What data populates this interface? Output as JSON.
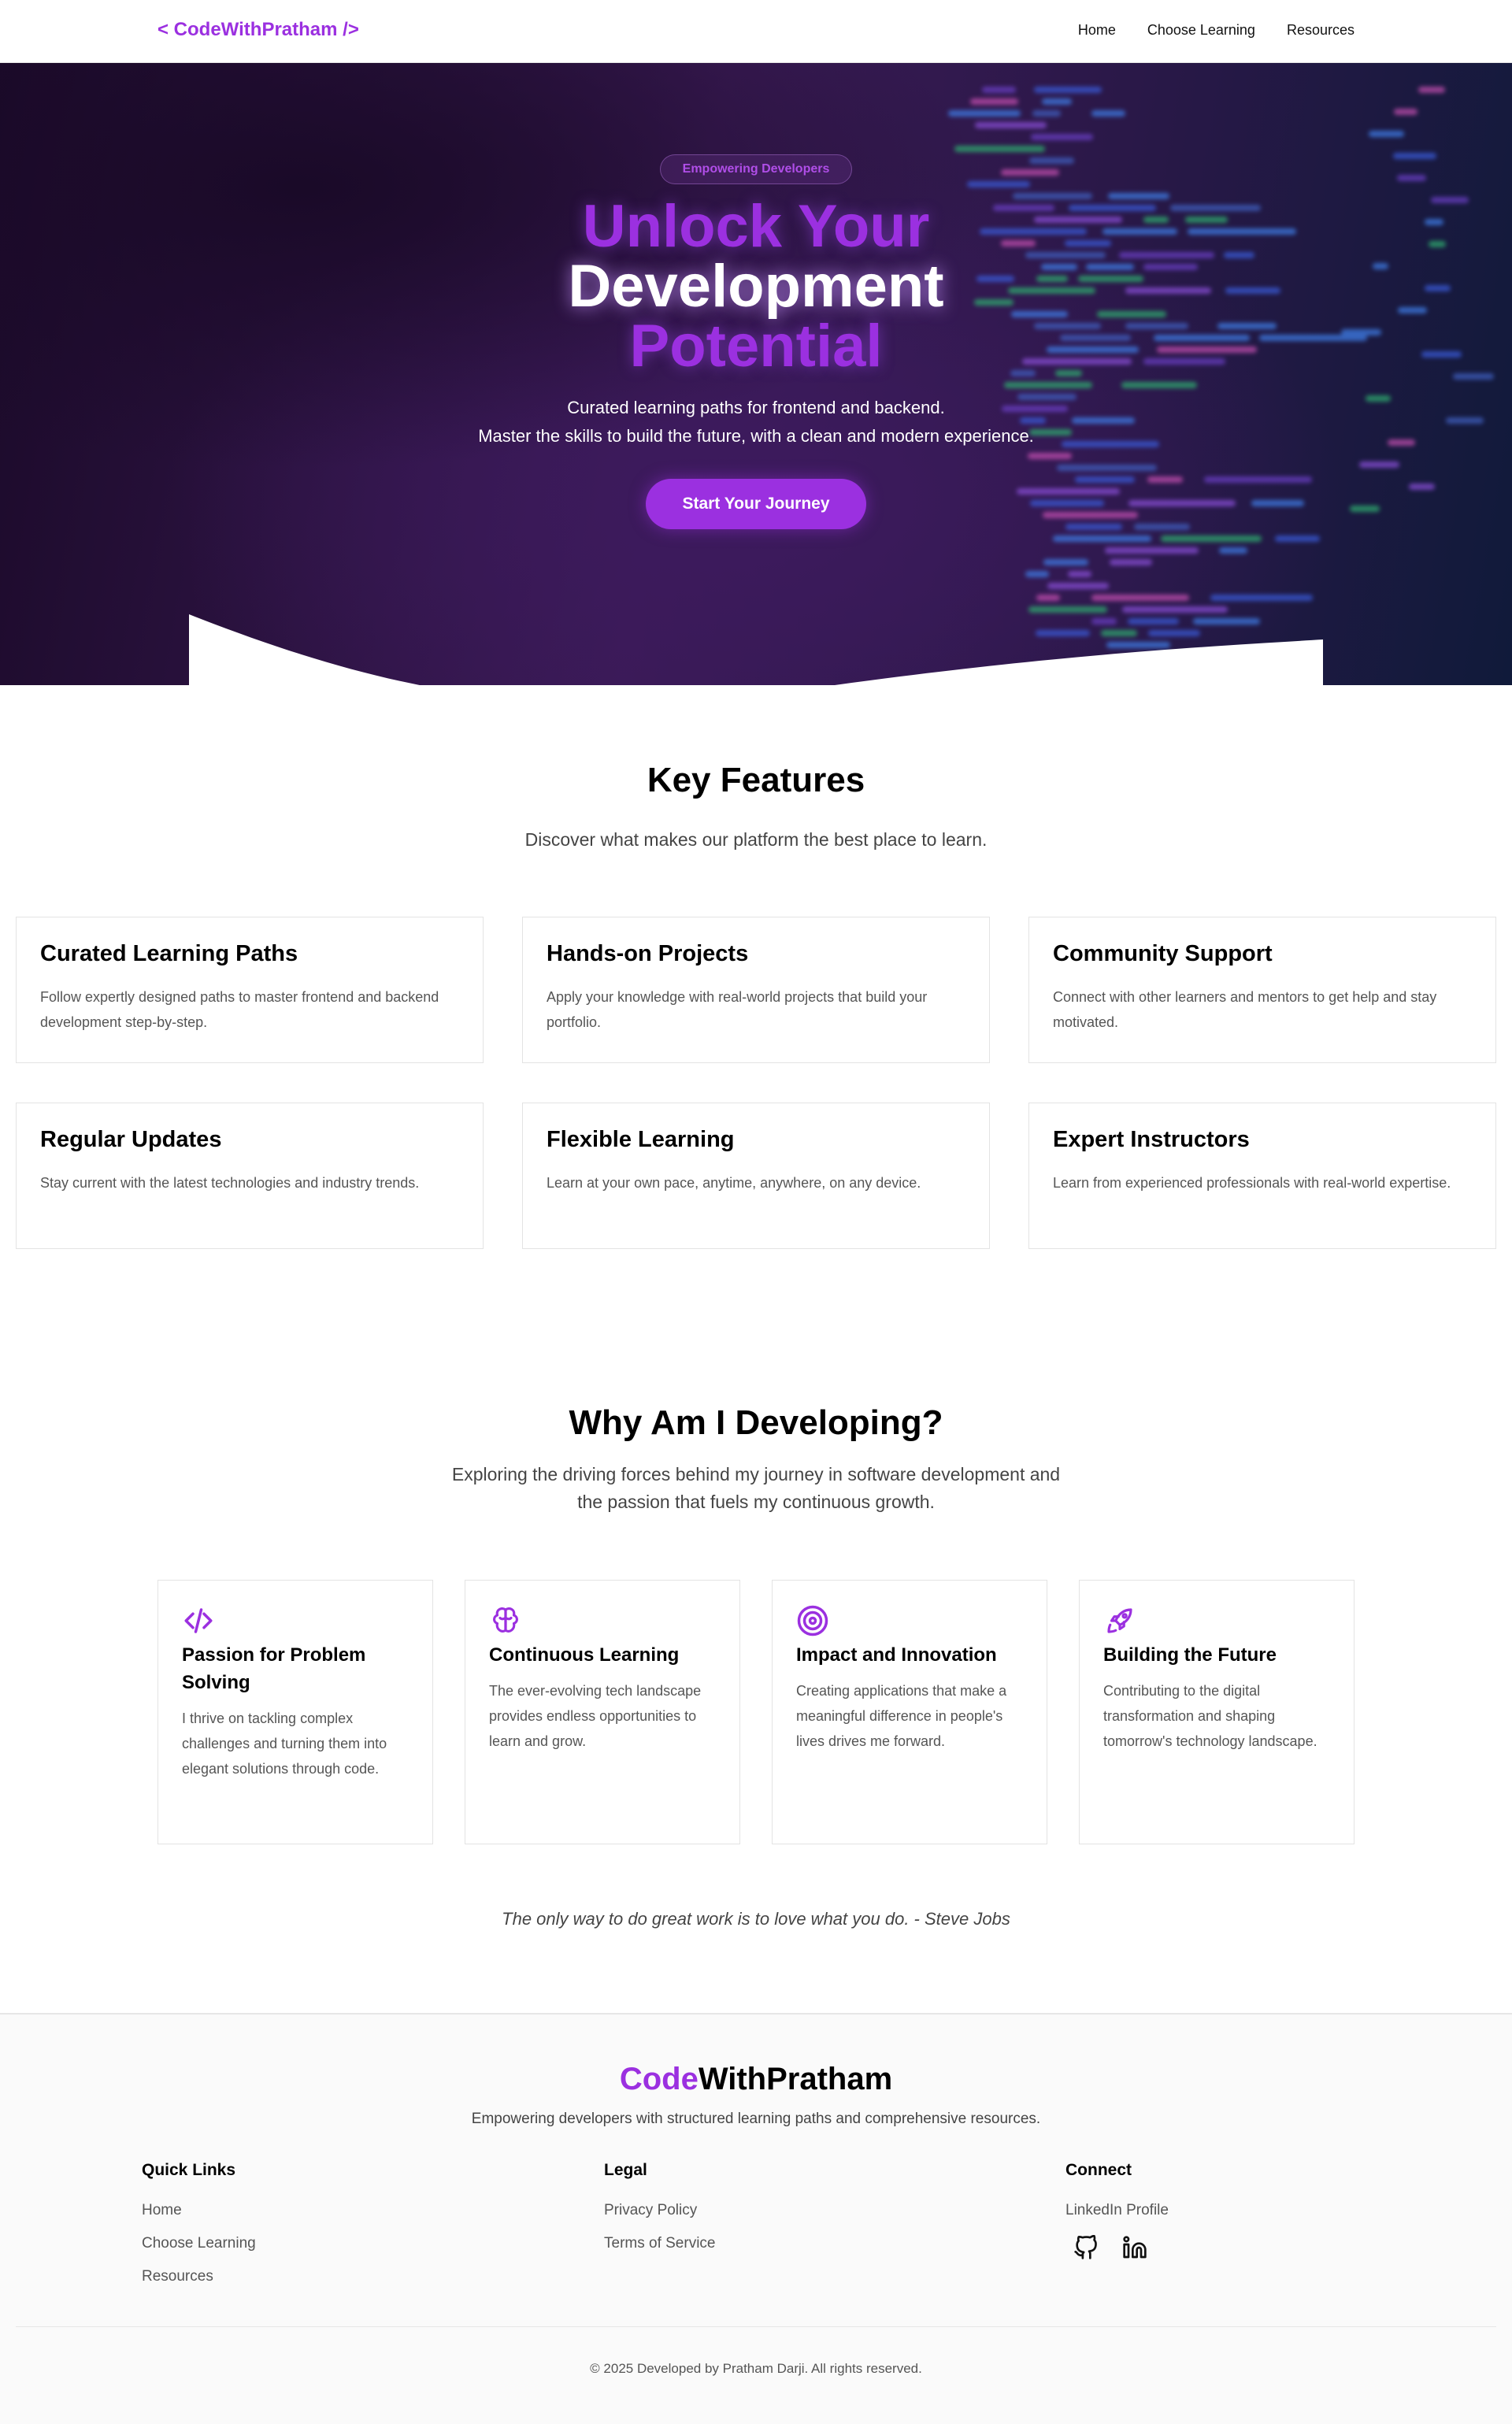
{
  "brand": {
    "logo_text": "< CodeWithPratham />",
    "accent_color": "#9b30e0"
  },
  "nav": {
    "items": [
      {
        "label": "Home"
      },
      {
        "label": "Choose Learning"
      },
      {
        "label": "Resources"
      }
    ]
  },
  "hero": {
    "badge": "Empowering Developers",
    "title_line1": "Unlock Your",
    "title_line2": "Development",
    "title_line3": "Potential",
    "subtitle_line1": "Curated learning paths for frontend and backend.",
    "subtitle_line2": "Master the skills to build the future, with a clean and modern experience.",
    "cta_label": "Start Your Journey"
  },
  "features": {
    "title": "Key Features",
    "subtitle": "Discover what makes our platform the best place to learn.",
    "cards": [
      {
        "title": "Curated Learning Paths",
        "text": "Follow expertly designed paths to master frontend and backend development step-by-step."
      },
      {
        "title": "Hands-on Projects",
        "text": "Apply your knowledge with real-world projects that build your portfolio."
      },
      {
        "title": "Community Support",
        "text": "Connect with other learners and mentors to get help and stay motivated."
      },
      {
        "title": "Regular Updates",
        "text": "Stay current with the latest technologies and industry trends."
      },
      {
        "title": "Flexible Learning",
        "text": "Learn at your own pace, anytime, anywhere, on any device."
      },
      {
        "title": "Expert Instructors",
        "text": "Learn from experienced professionals with real-world expertise."
      }
    ]
  },
  "why": {
    "title": "Why Am I Developing?",
    "subtitle": "Exploring the driving forces behind my journey in software development and the passion that fuels my continuous growth.",
    "cards": [
      {
        "icon": "code-icon",
        "title": "Passion for Problem Solving",
        "text": "I thrive on tackling complex challenges and turning them into elegant solutions through code."
      },
      {
        "icon": "brain-icon",
        "title": "Continuous Learning",
        "text": "The ever-evolving tech landscape provides endless opportunities to learn and grow."
      },
      {
        "icon": "target-icon",
        "title": "Impact and Innovation",
        "text": "Creating applications that make a meaningful difference in people's lives drives me forward."
      },
      {
        "icon": "rocket-icon",
        "title": "Building the Future",
        "text": "Contributing to the digital transformation and shaping tomorrow's technology landscape."
      }
    ],
    "quote": "The only way to do great work is to love what you do. - Steve Jobs"
  },
  "footer": {
    "brand_part1": "Code",
    "brand_part2": "WithPratham",
    "tagline": "Empowering developers with structured learning paths and comprehensive resources.",
    "quick_links": {
      "title": "Quick Links",
      "items": [
        "Home",
        "Choose Learning",
        "Resources"
      ]
    },
    "legal": {
      "title": "Legal",
      "items": [
        "Privacy Policy",
        "Terms of Service"
      ]
    },
    "connect": {
      "title": "Connect",
      "items": [
        "LinkedIn Profile"
      ],
      "icons": [
        "github-icon",
        "linkedin-icon"
      ]
    },
    "copyright": "© 2025 Developed by Pratham Darji. All rights reserved."
  }
}
